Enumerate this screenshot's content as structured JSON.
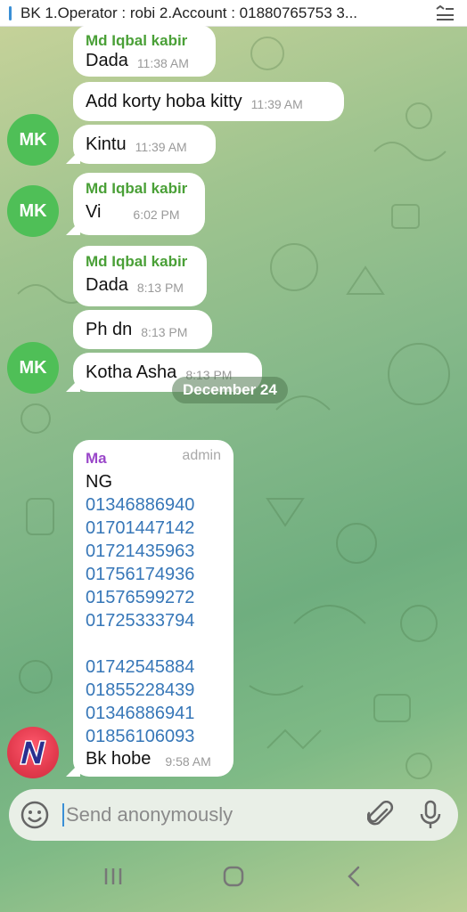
{
  "pinned": {
    "text": "BK 1.Operator : robi 2.Account  : 01880765753 3...",
    "icon": "pin-list-icon"
  },
  "messages": [
    {
      "sender": "Md Iqbal kabir",
      "text": "Dada",
      "time": "11:38 AM"
    },
    {
      "text": "Add korty hoba kitty",
      "time": "11:39 AM"
    },
    {
      "text": "Kintu",
      "time": "11:39 AM",
      "avatar": "MK"
    },
    {
      "sender": "Md Iqbal kabir",
      "text": "Vi",
      "time": "6:02 PM",
      "avatar": "MK"
    },
    {
      "sender": "Md Iqbal kabir",
      "text": "Dada",
      "time": "8:13 PM"
    },
    {
      "text": "Ph dn",
      "time": "8:13 PM"
    },
    {
      "text": "Kotha Asha",
      "time": "8:13 PM",
      "avatar": "MK"
    }
  ],
  "date_separator": "December 24",
  "admin_message": {
    "sender": "Ma",
    "role": "admin",
    "first_line": "NG",
    "numbers_group1": [
      "01346886940",
      "01701447142",
      "01721435963",
      "01756174936",
      "01576599272",
      "01725333794"
    ],
    "numbers_group2": [
      "01742545884",
      "01855228439",
      "01346886941",
      "01856106093"
    ],
    "last_line": "Bk hobe",
    "time": "9:58 AM"
  },
  "composer": {
    "placeholder": "Send anonymously"
  },
  "colors": {
    "sender_green": "#4aa037",
    "sender_purple": "#9a47c9",
    "link_blue": "#3777b8",
    "avatar_green": "#4fbf57"
  }
}
